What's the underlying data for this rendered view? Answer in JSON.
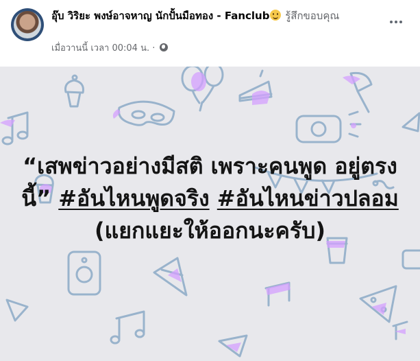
{
  "post": {
    "author": "อุ๊บ วิริยะ พงษ์อาจหาญ นักปั้นมือทอง - Fanclub",
    "status_text": "รู้สึกขอบคุณ",
    "timestamp": "เมื่อวานนี้ เวลา 00:04 น.",
    "separator": "·",
    "more_icon": "ellipsis-icon",
    "privacy_icon": "globe-icon",
    "feeling_icon": "smiling-face-emoji",
    "message": {
      "quote_line": "“เสพข่าวอย่างมีสติ เพราะคนพูด อยู่ตรงนี้”",
      "hashtag_1": "#อันไหนพูดจริง",
      "hashtag_2": "#อันไหนข่าวปลอม",
      "suffix": "(แยกแยะให้ออกนะครับ)"
    },
    "background": {
      "base_color": "#e8e8ec",
      "line_color": "#99b3cc",
      "accent_color": "#d4a0ff",
      "theme": "party-doodles"
    }
  }
}
